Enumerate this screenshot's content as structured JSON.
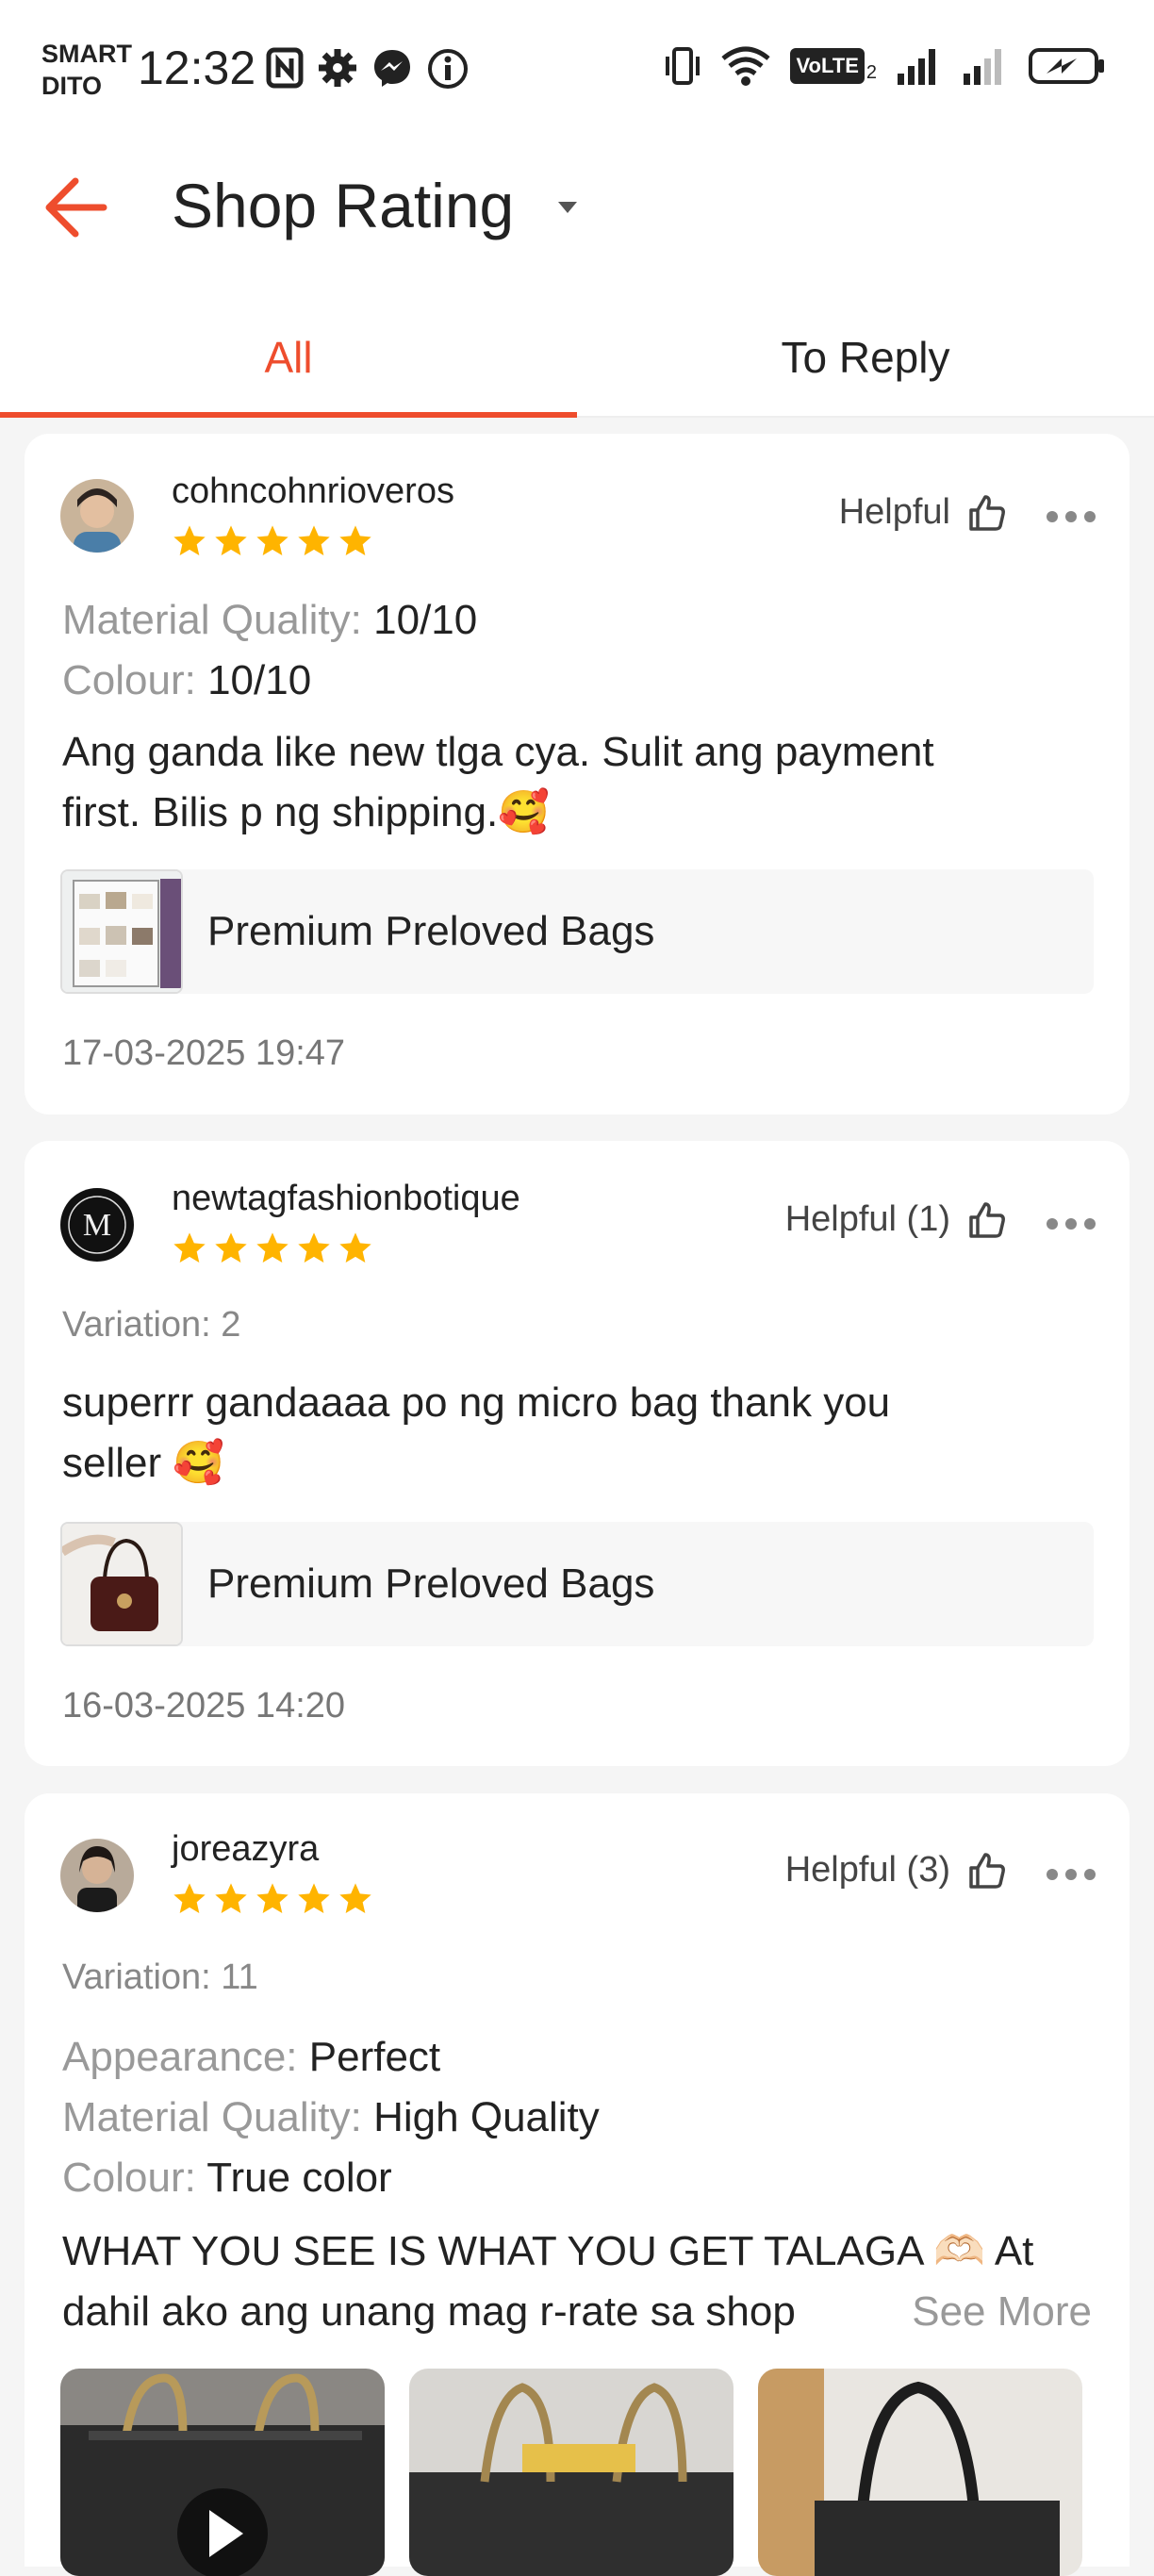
{
  "status_bar": {
    "carrier_line1": "SMART",
    "carrier_line2": "DITO",
    "time": "12:32",
    "volte_label": "VoLTE",
    "volte_sub": "2"
  },
  "header": {
    "title": "Shop Rating"
  },
  "tabs": [
    {
      "label": "All",
      "active": true
    },
    {
      "label": "To Reply",
      "active": false
    }
  ],
  "colors": {
    "accent": "#ee4d2d",
    "star": "#ffb400"
  },
  "reviews": [
    {
      "username": "cohncohnrioveros",
      "stars": 5,
      "helpful": "Helpful",
      "attributes": [
        {
          "key": "Material Quality:",
          "value": "10/10"
        },
        {
          "key": "Colour:",
          "value": "10/10"
        }
      ],
      "comment_line1": "Ang ganda like new tlga cya.  Sulit ang payment",
      "comment_line2": "first. Bilis p ng shipping.🥰",
      "product_name": "Premium Preloved Bags",
      "date": "17-03-2025 19:47"
    },
    {
      "username": "newtagfashionbotique",
      "stars": 5,
      "helpful": "Helpful (1)",
      "variation": "Variation: 2",
      "comment_line1": "superrr gandaaaa po ng micro bag  thank you",
      "comment_line2": "seller 🥰",
      "product_name": "Premium Preloved Bags",
      "date": "16-03-2025 14:20"
    },
    {
      "username": "joreazyra",
      "stars": 5,
      "helpful": "Helpful (3)",
      "variation": "Variation: 11",
      "attributes": [
        {
          "key": "Appearance:",
          "value": "Perfect"
        },
        {
          "key": "Material Quality:",
          "value": "High Quality"
        },
        {
          "key": "Colour:",
          "value": "True color"
        }
      ],
      "comment_line1": "WHAT YOU SEE IS WHAT YOU GET TALAGA 🫶🏻 At",
      "comment_line2": "dahil ako ang unang mag r-rate sa shop",
      "see_more": "See More"
    }
  ]
}
